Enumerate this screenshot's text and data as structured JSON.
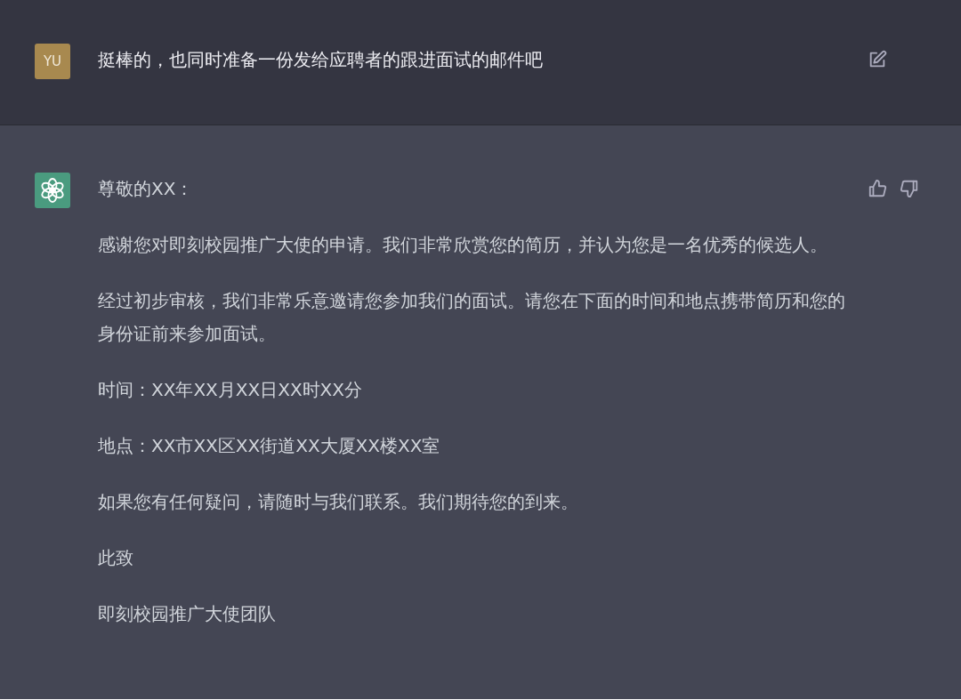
{
  "user_message": {
    "avatar": "YU",
    "text": "挺棒的，也同时准备一份发给应聘者的跟进面试的邮件吧"
  },
  "assistant_message": {
    "paragraphs": [
      "尊敬的XX：",
      "感谢您对即刻校园推广大使的申请。我们非常欣赏您的简历，并认为您是一名优秀的候选人。",
      "经过初步审核，我们非常乐意邀请您参加我们的面试。请您在下面的时间和地点携带简历和您的身份证前来参加面试。",
      "时间：XX年XX月XX日XX时XX分",
      "地点：XX市XX区XX街道XX大厦XX楼XX室",
      "如果您有任何疑问，请随时与我们联系。我们期待您的到来。",
      "此致",
      "即刻校园推广大使团队"
    ]
  }
}
